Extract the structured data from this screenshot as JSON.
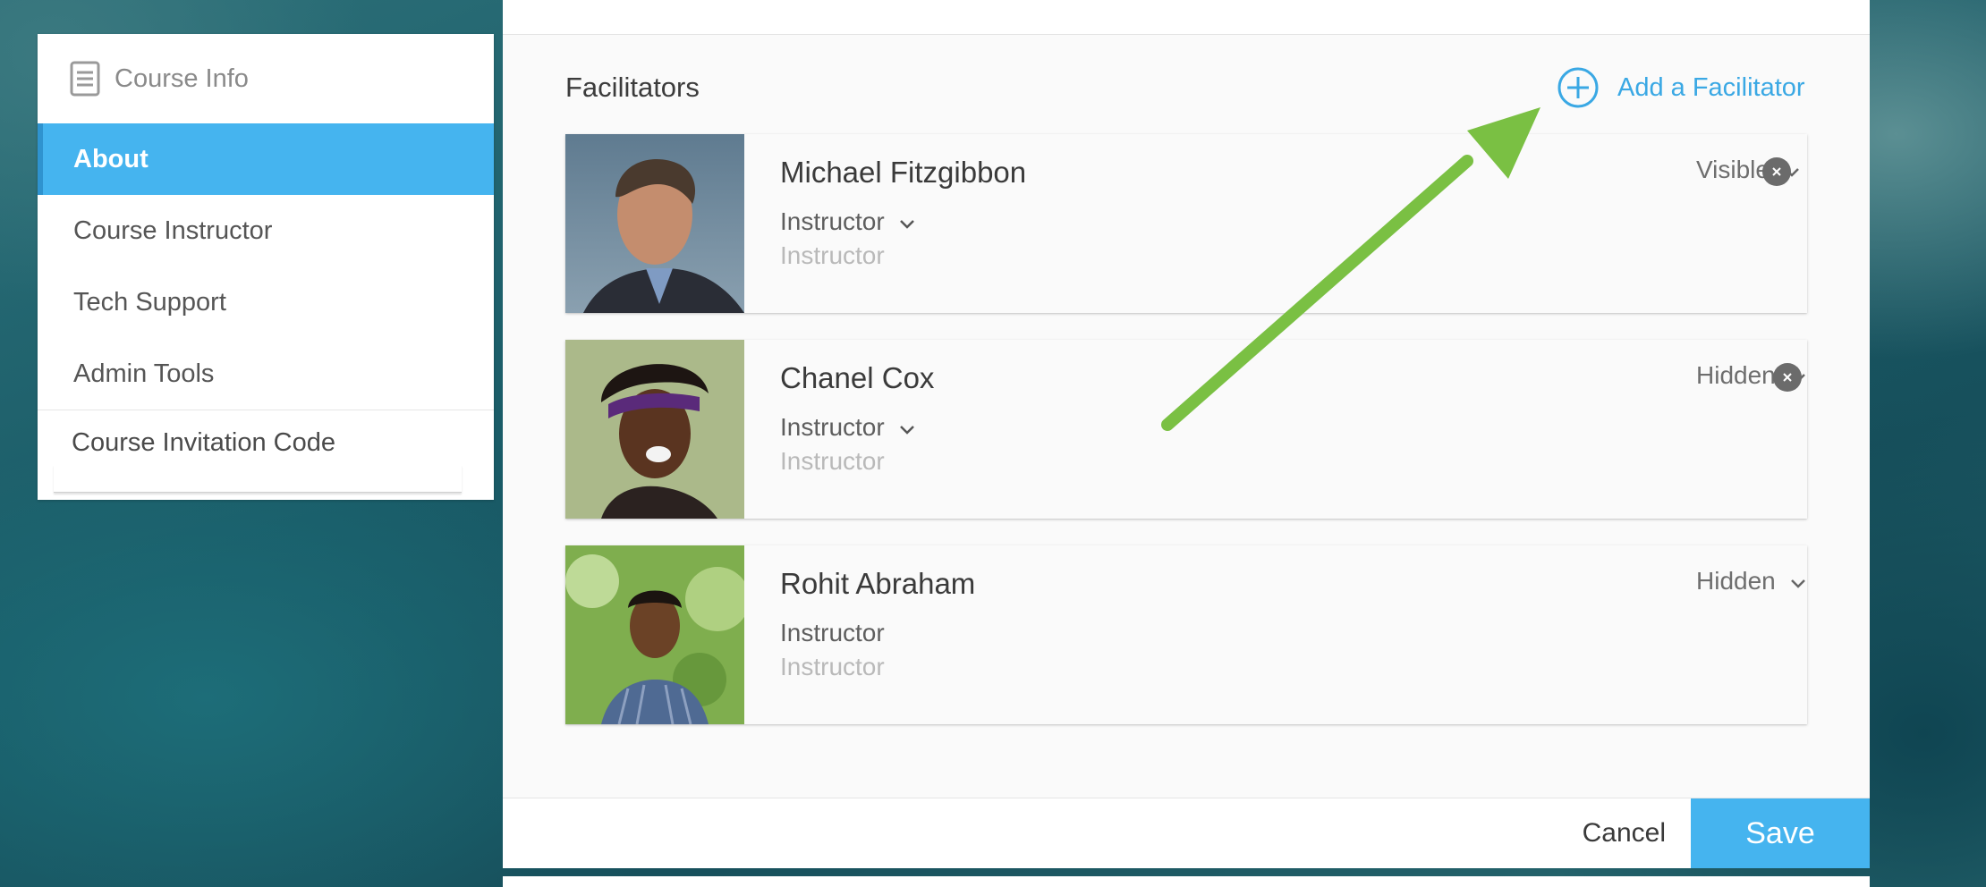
{
  "sidebar": {
    "title": "Course Info",
    "title_icon": "document-icon",
    "items": [
      {
        "label": "About",
        "active": true
      },
      {
        "label": "Course Instructor",
        "active": false
      },
      {
        "label": "Tech Support",
        "active": false
      },
      {
        "label": "Admin Tools",
        "active": false
      }
    ],
    "invitation_label": "Course Invitation Code"
  },
  "main": {
    "section_title": "Facilitators",
    "add_label": "Add a Facilitator",
    "facilitators": [
      {
        "name": "Michael Fitzgibbon",
        "role": "Instructor",
        "subrole": "Instructor",
        "visibility": "Visible",
        "removable": true
      },
      {
        "name": "Chanel Cox",
        "role": "Instructor",
        "subrole": "Instructor",
        "visibility": "Hidden",
        "removable": true
      },
      {
        "name": "Rohit Abraham",
        "role": "Instructor",
        "subrole": "Instructor",
        "visibility": "Hidden",
        "removable": false
      }
    ]
  },
  "footer": {
    "cancel_label": "Cancel",
    "save_label": "Save"
  },
  "colors": {
    "accent": "#45b4ef",
    "link": "#3aa8e4",
    "annotation_arrow": "#7ac043"
  }
}
